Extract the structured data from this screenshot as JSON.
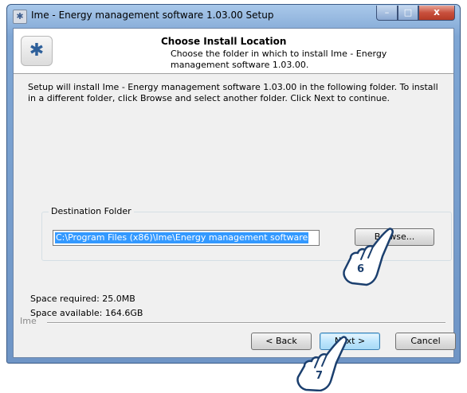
{
  "window": {
    "title": "Ime - Energy management software 1.03.00 Setup",
    "controls": {
      "minimize": "–",
      "maximize": "□",
      "close": "x"
    }
  },
  "header": {
    "title": "Choose Install Location",
    "subtitle": "Choose the folder in which to install Ime - Energy management software 1.03.00."
  },
  "body": {
    "intro": "Setup will install Ime - Energy management software 1.03.00 in the following folder. To install in a different folder, click Browse and select another folder. Click Next to continue.",
    "destination_label": "Destination Folder",
    "destination_value": "C:\\Program Files (x86)\\Ime\\Energy management software",
    "browse_label": "Browse...",
    "space_required": "Space required: 25.0MB",
    "space_available": "Space available: 164.6GB"
  },
  "footer": {
    "brand": "Ime",
    "back_label": "< Back",
    "next_label": "Next >",
    "cancel_label": "Cancel"
  },
  "callouts": {
    "browse_step": "6",
    "next_step": "7"
  },
  "colors": {
    "selection": "#3399ff",
    "close_button": "#c8503d",
    "callout": "#1b3f6e"
  }
}
